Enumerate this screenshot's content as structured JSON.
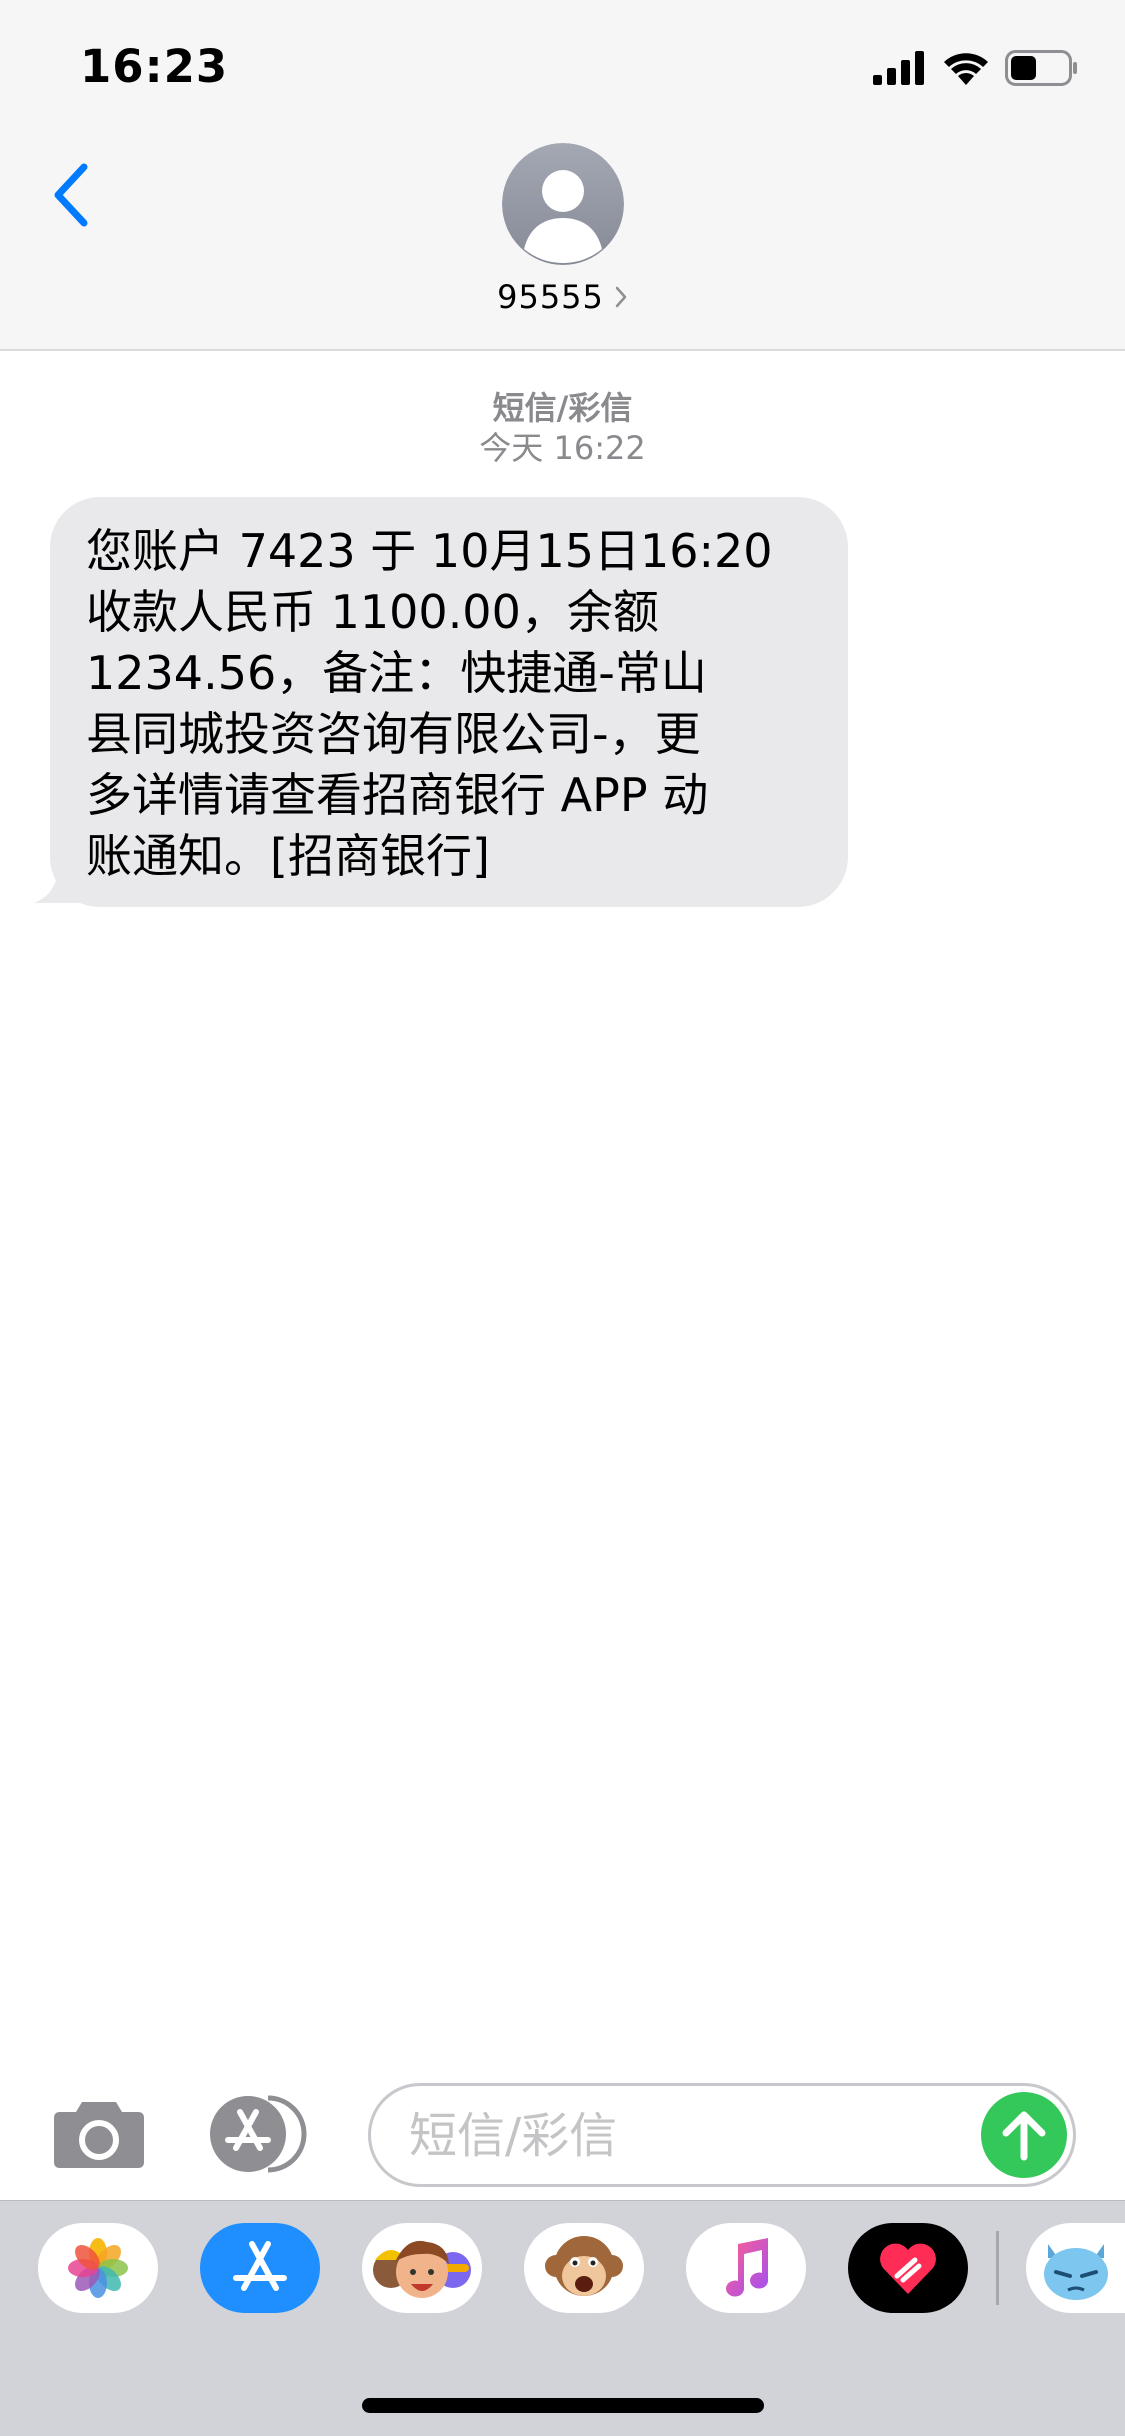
{
  "status_bar": {
    "time": "16:23",
    "icons": [
      "cellular-signal-icon",
      "wifi-icon",
      "battery-icon"
    ],
    "battery_level": 0.45
  },
  "header": {
    "back_icon": "chevron-left-icon",
    "contact_number": "95555",
    "contact_chevron": "›"
  },
  "conversation": {
    "service_type": "短信/彩信",
    "timestamp": "今天 16:22",
    "message_lines": [
      "您账户 7423 于 10月15日16:20",
      "收款人民币 1100.00，余额",
      "1234.56，备注：快捷通-常山",
      "县同城投资咨询有限公司-，更",
      "多详情请查看招商银行 APP 动",
      "账通知。[招商银行]"
    ]
  },
  "composer": {
    "placeholder": "短信/彩信",
    "value": "",
    "camera_icon": "camera-icon",
    "apps_icon": "app-store-icon",
    "send_icon": "send-arrow-up-icon"
  },
  "app_drawer": {
    "apps": [
      "photos-icon",
      "app-store-icon",
      "memoji-icon",
      "animoji-monkey-icon",
      "music-icon",
      "digital-touch-heart-icon",
      "animoji-alien-icon"
    ]
  },
  "colors": {
    "accent": "#007aff",
    "send": "#34c759",
    "bubble": "#e9e9eb",
    "header_bg": "#f6f6f7",
    "drawer_bg": "#d1d3d9"
  }
}
